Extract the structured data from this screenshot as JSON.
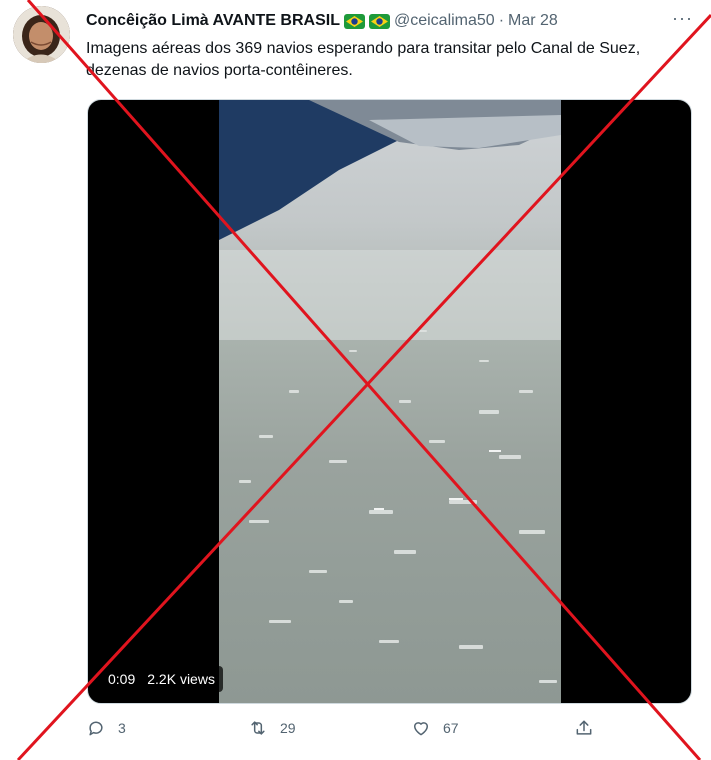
{
  "tweet": {
    "display_name": "Concêição Limà AVANTE BRASIL",
    "handle": "@ceicalima50",
    "separator": "·",
    "date": "Mar 28",
    "more_label": "···",
    "text_line1": "Imagens aéreas dos 369 navios esperando para transitar pelo Canal de Suez,",
    "text_line2": "dezenas de navios porta-contêineres."
  },
  "video": {
    "time": "0:09",
    "views": "2.2K views"
  },
  "actions": {
    "reply_count": "3",
    "retweet_count": "29",
    "like_count": "67"
  },
  "colors": {
    "cross": "#e0141e",
    "muted_text": "#536471",
    "flag_green": "#1e9a3a",
    "flag_yellow": "#f7d117",
    "flag_blue": "#1a3d8f"
  },
  "icons": {
    "reply": "reply-icon",
    "retweet": "retweet-icon",
    "like": "heart-icon",
    "share": "share-icon",
    "more": "more-icon",
    "flag": "brazil-flag-icon"
  }
}
